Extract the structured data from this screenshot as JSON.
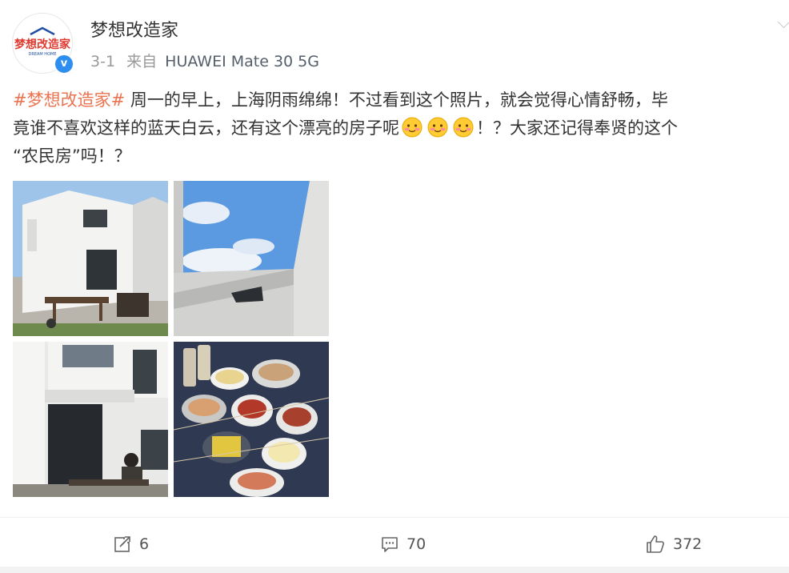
{
  "user": {
    "name": "梦想改造家",
    "avatar_logo_text": "梦想改造家",
    "avatar_logo_sub": "DREAM HOME"
  },
  "post": {
    "date": "3-1",
    "from_label": "来自",
    "device": "HUAWEI Mate 30 5G",
    "topic": "#梦想改造家#",
    "line1_rest": " 周一的早上，上海阴雨绵绵！不过看到这个照片，就会觉得心情舒畅，毕",
    "line2_a": "竟谁不喜欢这样的蓝天白云，还有这个漂亮的房子呢",
    "line2_b": "！？大家还记得奉贤的这个",
    "line3": "“农民房”吗！？"
  },
  "photos": [
    {
      "name": "house-exterior-photo"
    },
    {
      "name": "sky-rooftop-photo"
    },
    {
      "name": "house-patio-photo"
    },
    {
      "name": "bbq-food-photo"
    }
  ],
  "actions": {
    "repost_count": "6",
    "comment_count": "70",
    "like_count": "372"
  },
  "colors": {
    "topic": "#eb7350",
    "verify_badge": "#2e8ef0",
    "meta_text": "#999999"
  }
}
